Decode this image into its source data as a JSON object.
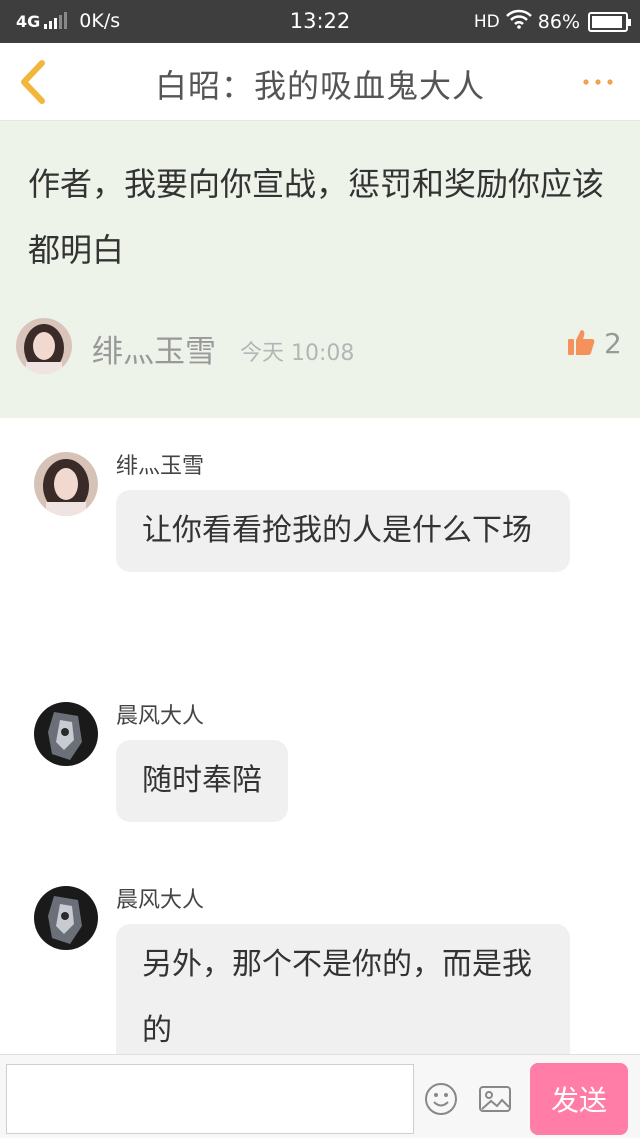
{
  "status_bar": {
    "network": "4G",
    "speed": "0K/s",
    "time": "13:22",
    "hd": "HD",
    "battery": "86%"
  },
  "header": {
    "title": "白昭：我的吸血鬼大人",
    "back_icon": "chevron-left-icon",
    "more_icon": "more-dots-icon",
    "accent_color": "#f2b63c"
  },
  "post": {
    "content": "作者，我要向你宣战，惩罚和奖励你应该都明白",
    "author": "绯灬玉雪",
    "time": "今天 10:08",
    "likes": "2",
    "background": "#eef3ea"
  },
  "comments": [
    {
      "author": "绯灬玉雪",
      "text": "让你看看抢我的人是什么下场",
      "avatar": "girl-avatar"
    },
    {
      "author": "晨风大人",
      "text": "随时奉陪",
      "avatar": "dark-avatar"
    },
    {
      "author": "晨风大人",
      "text": "另外，那个不是你的，而是我的",
      "avatar": "dark-avatar"
    }
  ],
  "input_bar": {
    "placeholder": "",
    "send_label": "发送",
    "send_color": "#ff7da6"
  }
}
